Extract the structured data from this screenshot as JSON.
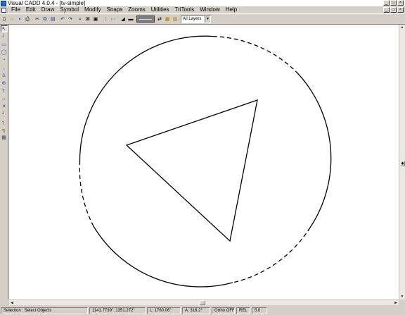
{
  "window": {
    "title": "Visual CADD 4.0.4 - [tv-simple]",
    "controls": {
      "minimize": "_",
      "maximize": "□",
      "close": "×"
    }
  },
  "menu": {
    "items": [
      "File",
      "Edit",
      "Draw",
      "Symbol",
      "Modify",
      "Snaps",
      "Zooms",
      "Utilities",
      "TriTools",
      "Window",
      "Help"
    ]
  },
  "toolbar": {
    "layer_select": "All Layers",
    "layer_arrow": "▼",
    "buttons": {
      "new": "▯",
      "open": "⌂",
      "save": "▪",
      "print": "⎙",
      "cut": "✂",
      "copy": "⧉",
      "paste": "▤",
      "undo": "↶",
      "redo": "↷",
      "zoom_window": "⌕",
      "zoom_all": "⊠",
      "zoom_fit": "▣",
      "grid": "⋮",
      "snap": "⋯",
      "color": "◢",
      "pen": "▬",
      "layer_mgr": "⇄",
      "layers1": "▦",
      "layers2": "▥"
    }
  },
  "sidebar": {
    "tools": [
      {
        "name": "select-tool-icon",
        "glyph": "↖",
        "color": "#000000"
      },
      {
        "name": "line-tool-icon",
        "glyph": "┘",
        "color": "#3355aa"
      },
      {
        "name": "rectangle-tool-icon",
        "glyph": "▭",
        "color": "#3355aa"
      },
      {
        "name": "circle-tool-icon",
        "glyph": "◯",
        "color": "#3355aa"
      },
      {
        "name": "arc-tool-icon",
        "glyph": "◔",
        "color": "#3355aa"
      },
      {
        "name": "curve-tool-icon",
        "glyph": "◟",
        "color": "#3355aa"
      },
      {
        "name": "symbol-tool-icon",
        "glyph": "♙",
        "color": "#3355aa"
      },
      {
        "name": "hatch-tool-icon",
        "glyph": "⊕",
        "color": "#3355aa"
      },
      {
        "name": "text-tool-icon",
        "glyph": "T",
        "color": "#3355aa"
      },
      {
        "name": "dimension-tool-icon",
        "glyph": "↔",
        "color": "#3355aa"
      },
      {
        "name": "trim-tool-icon",
        "glyph": "✕",
        "color": "#555555"
      },
      {
        "name": "fillet-tool-icon",
        "glyph": "╯",
        "color": "#aa2200"
      },
      {
        "name": "chamfer-tool-icon",
        "glyph": "╮",
        "color": "#aa2200"
      },
      {
        "name": "offset-tool-icon",
        "glyph": "╗",
        "color": "#885500"
      },
      {
        "name": "properties-tool-icon",
        "glyph": "▦",
        "color": "#444466"
      }
    ]
  },
  "scrollbars": {
    "up": "▲",
    "down": "▼",
    "left": "◀",
    "right": "▶",
    "thumb": "◆"
  },
  "status": {
    "prompt": "Selection : Select Objects",
    "coords": "1141.7739\"   ,1351.272\"",
    "length": "L: 1760.06\"",
    "angle": "A: 318.2°",
    "ortho": "Ortho OFF",
    "mode": "REL",
    "scale": "5.0"
  }
}
